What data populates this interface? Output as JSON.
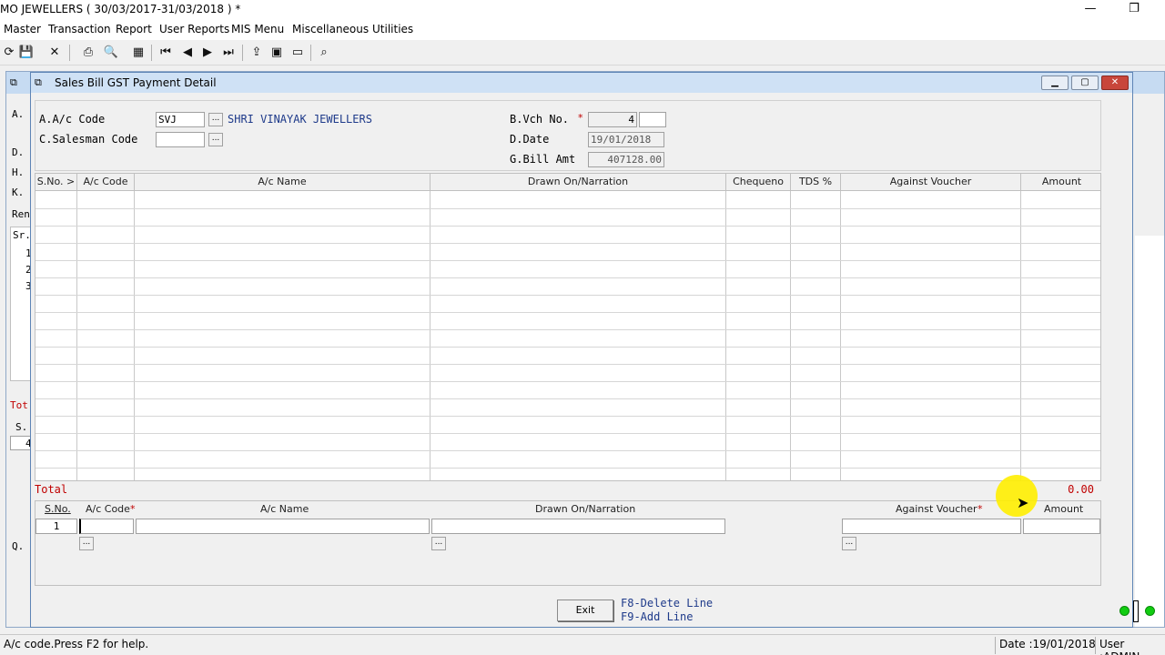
{
  "window": {
    "title": "MO JEWELLERS ( 30/03/2017-31/03/2018 ) *",
    "minimize": "—",
    "restore": "❐"
  },
  "menu": [
    "Master",
    "Transaction",
    "Report",
    "User Reports",
    "MIS Menu",
    "Miscellaneous",
    "Utilities"
  ],
  "background_form": {
    "labels": [
      "A.",
      "D.",
      "H.",
      "K.",
      "Ren",
      "Sr.",
      "1",
      "2",
      "3",
      "Tot",
      "S.",
      "Q.",
      "4"
    ]
  },
  "dialog": {
    "title": "Sales Bill GST Payment Detail",
    "title_icon": "window-icon",
    "fields": {
      "ac_code_label": "A.A/c Code",
      "ac_code_value": "SVJ",
      "ac_name": "SHRI VINAYAK JEWELLERS",
      "salesman_label": "C.Salesman Code",
      "salesman_value": "",
      "vch_label": "B.Vch No.",
      "vch_value": "4",
      "vch_suffix": "",
      "date_label": "D.Date",
      "date_value": "19/01/2018",
      "bill_amt_label": "G.Bill Amt",
      "bill_amt_value": "407128.00"
    },
    "grid_columns": [
      "S.No. >",
      "A/c Code",
      "A/c Name",
      "Drawn On/Narration",
      "Chequeno",
      "TDS %",
      "Against Voucher",
      "Amount"
    ],
    "total_label": "Total",
    "total_value": "0.00",
    "entry": {
      "headers": [
        "S.No.",
        "A/c Code",
        "A/c Name",
        "Drawn On/Narration",
        "Against Voucher",
        "Amount"
      ],
      "sno": "1",
      "ac_code": "",
      "ac_name": "",
      "narration": "",
      "against_voucher": "",
      "amount": ""
    },
    "exit_label": "Exit",
    "hints": [
      "F8-Delete Line",
      "F9-Add Line"
    ]
  },
  "status": {
    "help": "A/c code.Press F2 for help.",
    "date": "Date :19/01/2018",
    "user": "User :ADMIN"
  },
  "colors": {
    "accent_blue": "#1e3a8a",
    "required_red": "#c00000",
    "total_red": "#c00000",
    "dialog_title_bg": "#cfe1f5"
  }
}
